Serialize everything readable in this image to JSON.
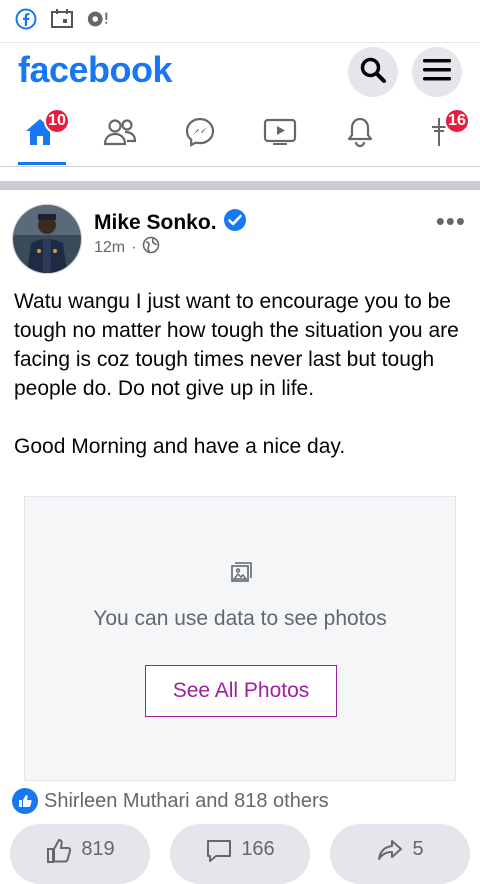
{
  "statusbar": {
    "icons": [
      "facebook-icon",
      "calendar-icon",
      "bubble-icon"
    ]
  },
  "header": {
    "logo": "facebook",
    "search_icon": "search-icon",
    "menu_icon": "menu-icon"
  },
  "nav": {
    "items": [
      {
        "name": "home",
        "icon": "home-icon",
        "badge": "10",
        "active": true
      },
      {
        "name": "friends",
        "icon": "friends-icon",
        "badge": ""
      },
      {
        "name": "messenger",
        "icon": "messenger-icon",
        "badge": ""
      },
      {
        "name": "watch",
        "icon": "watch-icon",
        "badge": ""
      },
      {
        "name": "notifications",
        "icon": "bell-icon",
        "badge": ""
      },
      {
        "name": "pages",
        "icon": "flag-icon",
        "badge": "16"
      }
    ]
  },
  "post": {
    "author": "Mike Sonko.",
    "verified": true,
    "time": "12m",
    "privacy": "globe-icon",
    "text": "Watu wangu I just want to encourage you to be tough no matter how tough the situation you are facing is coz tough times never last but tough people do. Do not give up in life.\n\nGood Morning and have a nice day.",
    "photo_message": "You can use data to see photos",
    "see_all_label": "See All Photos",
    "reactions_text": "Shirleen Muthari and 818 others",
    "likes": "819",
    "comments": "166",
    "shares": "5"
  },
  "colors": {
    "brand": "#1877f2",
    "badge": "#e41e3f",
    "see_all": "#a020a0"
  }
}
